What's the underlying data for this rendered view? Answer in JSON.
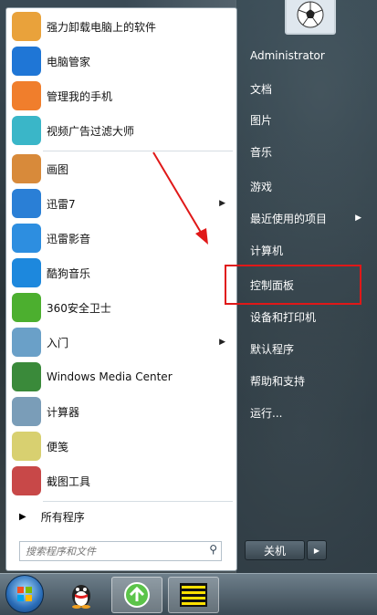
{
  "left_programs": [
    {
      "label": "强力卸载电脑上的软件",
      "icon": "uninstall-icon",
      "color": "#e9a23b",
      "arrow": false
    },
    {
      "label": "电脑管家",
      "icon": "shield-icon",
      "color": "#1f76d6",
      "arrow": false
    },
    {
      "label": "管理我的手机",
      "icon": "pinwheel-icon",
      "color": "#f07e2c",
      "arrow": false
    },
    {
      "label": "视频广告过滤大师",
      "icon": "clock-filter-icon",
      "color": "#3ab6c8",
      "arrow": false
    },
    {
      "label": "画图",
      "icon": "paint-palette-icon",
      "color": "#d88a3a",
      "arrow": false
    },
    {
      "label": "迅雷7",
      "icon": "thunder-bird-icon",
      "color": "#2a7fd6",
      "arrow": true
    },
    {
      "label": "迅雷影音",
      "icon": "play-swirl-icon",
      "color": "#2d8ee0",
      "arrow": false
    },
    {
      "label": "酷狗音乐",
      "icon": "kugou-icon",
      "color": "#1d88dd",
      "arrow": false
    },
    {
      "label": "360安全卫士",
      "icon": "cross-shield-icon",
      "color": "#4caf2f",
      "arrow": false
    },
    {
      "label": "入门",
      "icon": "document-icon",
      "color": "#6aa0c8",
      "arrow": true
    },
    {
      "label": "Windows Media Center",
      "icon": "windows-logo-icon",
      "color": "#3a8a3a",
      "arrow": false
    },
    {
      "label": "计算器",
      "icon": "calculator-icon",
      "color": "#7a9db8",
      "arrow": false
    },
    {
      "label": "便笺",
      "icon": "sticky-note-icon",
      "color": "#d8d070",
      "arrow": false
    },
    {
      "label": "截图工具",
      "icon": "scissors-icon",
      "color": "#c84848",
      "arrow": false
    }
  ],
  "all_programs": {
    "label": "所有程序",
    "icon": "triangle-right-icon"
  },
  "search": {
    "placeholder": "搜索程序和文件",
    "icon": "magnifier-icon"
  },
  "right_items": [
    {
      "label": "Administrator",
      "arrow": false
    },
    {
      "label": "文档",
      "arrow": false
    },
    {
      "label": "图片",
      "arrow": false
    },
    {
      "label": "音乐",
      "arrow": false
    },
    {
      "label": "游戏",
      "arrow": false
    },
    {
      "label": "最近使用的项目",
      "arrow": true
    },
    {
      "label": "计算机",
      "arrow": false
    },
    {
      "label": "控制面板",
      "arrow": false
    },
    {
      "label": "设备和打印机",
      "arrow": false
    },
    {
      "label": "默认程序",
      "arrow": false
    },
    {
      "label": "帮助和支持",
      "arrow": false
    },
    {
      "label": "运行...",
      "arrow": false
    }
  ],
  "shutdown": {
    "label": "关机",
    "arrow_icon": "triangle-right-icon"
  },
  "avatar": {
    "icon": "soccer-ball-icon"
  },
  "taskbar": {
    "start_icon": "windows-orb-icon",
    "buttons": [
      {
        "icon": "qq-penguin-icon"
      },
      {
        "icon": "green-arrow-icon"
      },
      {
        "icon": "yellow-lines-icon"
      }
    ]
  },
  "annotation": {
    "color": "#e01818"
  }
}
